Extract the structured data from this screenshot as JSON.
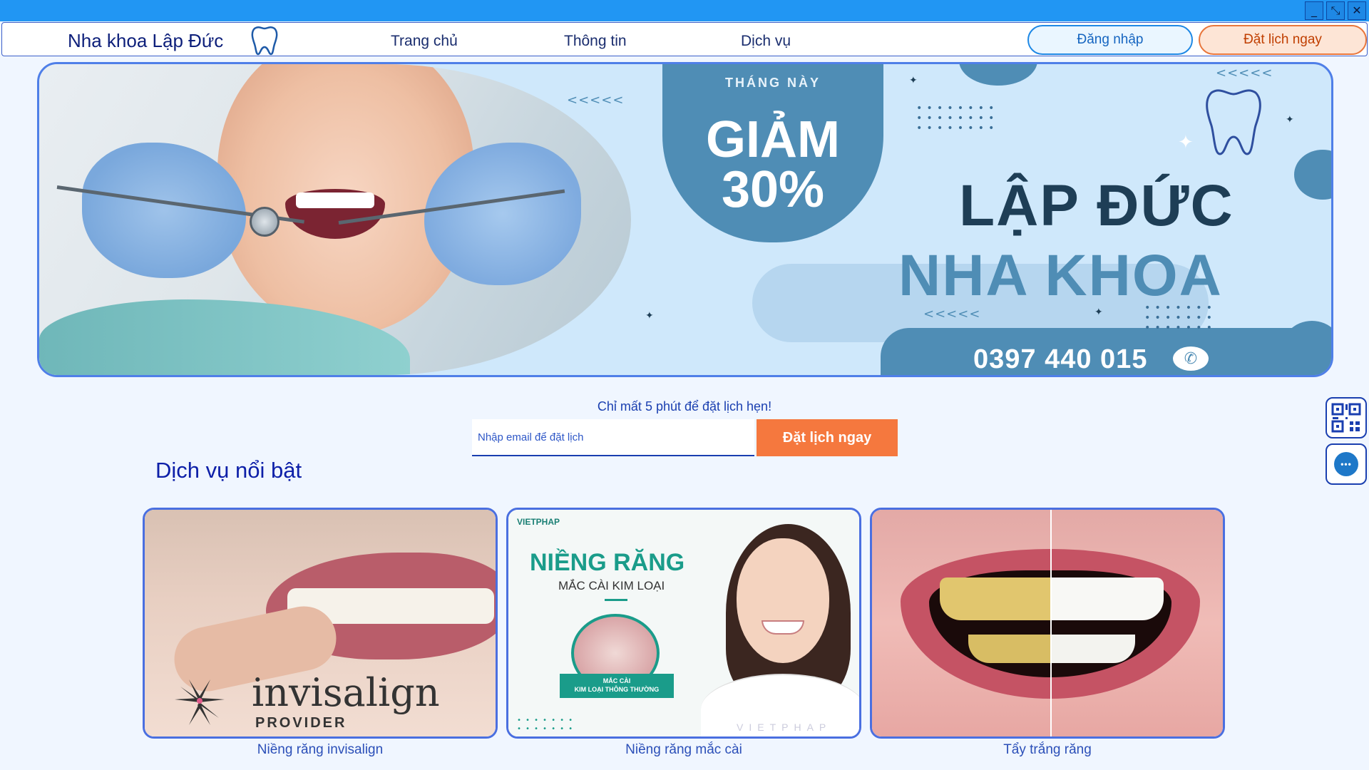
{
  "window": {
    "minimize_icon": "minimize-icon",
    "restore_icon": "restore-icon",
    "close_icon": "close-icon",
    "minimize_glyph": "_",
    "restore_glyph": "⤡",
    "close_glyph": "✕"
  },
  "nav": {
    "brand": "Nha khoa Lập Đức",
    "links": [
      "Trang chủ",
      "Thông tin",
      "Dịch vụ"
    ],
    "login_label": "Đăng nhập",
    "book_label": "Đặt lịch ngay"
  },
  "banner": {
    "promo_small": "THÁNG NÀY",
    "promo_word": "GIẢM",
    "promo_percent": "30%",
    "brand_line1": "LẬP ĐỨC",
    "brand_line2": "NHA KHOA",
    "phone": "0397 440 015",
    "chevrons": "<<<<<"
  },
  "booking": {
    "tagline": "Chỉ mất 5 phút để đặt lịch hẹn!",
    "email_placeholder": "Nhập email để đặt lịch",
    "email_value": "",
    "button_label": "Đặt lịch ngay"
  },
  "services": {
    "title": "Dịch vụ nổi bật",
    "items": [
      {
        "caption": "Niềng răng invisalign",
        "image_text": {
          "wordmark": "invisalign",
          "provider": "PROVIDER"
        }
      },
      {
        "caption": "Niềng răng mắc cài",
        "image_text": {
          "brand": "VIETPHAP",
          "title": "NIỀNG RĂNG",
          "subtitle": "MẮC CÀI KIM LOẠI",
          "tag_line1": "MẮC CÀI",
          "tag_line2": "KIM LOẠI THÔNG THƯỜNG",
          "watermark": "VIETPHAP"
        }
      },
      {
        "caption": "Tẩy trắng răng",
        "image_text": {}
      }
    ]
  },
  "side": {
    "qr_icon": "qr-code-icon",
    "chat_icon": "chat-bubble-icon",
    "chat_glyph": "•••"
  },
  "colors": {
    "titlebar": "#2196f3",
    "accent": "#f5783e",
    "brand_blue": "#4f8db5",
    "link_blue": "#1a3fb0"
  }
}
